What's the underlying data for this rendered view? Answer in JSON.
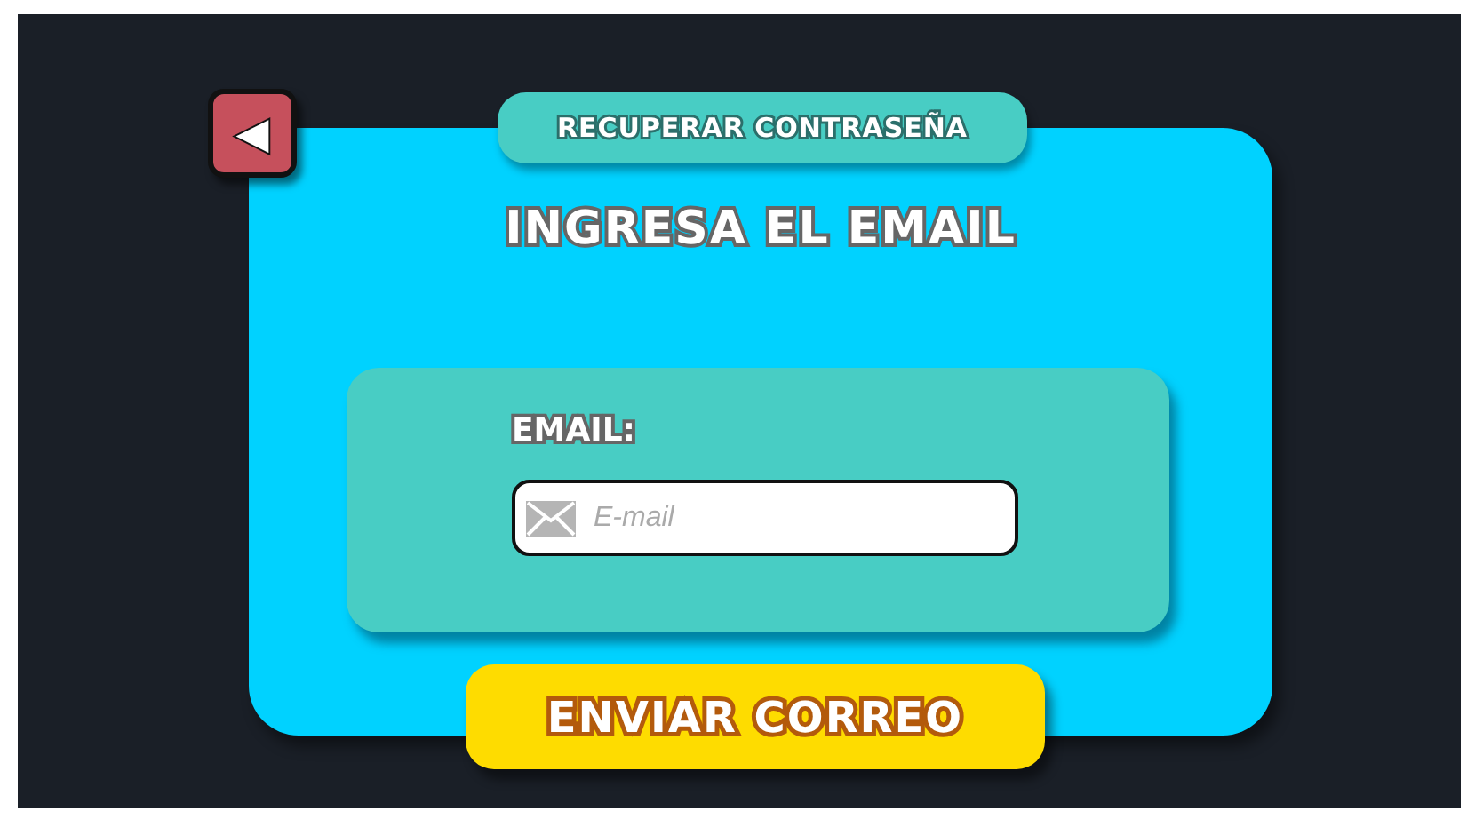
{
  "back_button": {
    "label": "◀"
  },
  "header": {
    "title": "RECUPERAR CONTRASEÑA"
  },
  "heading": "INGRESA EL EMAIL",
  "form": {
    "label": "EMAIL:",
    "email_field": {
      "placeholder": "E-mail"
    }
  },
  "submit_button": {
    "label": "ENVIAR CORREO"
  }
}
